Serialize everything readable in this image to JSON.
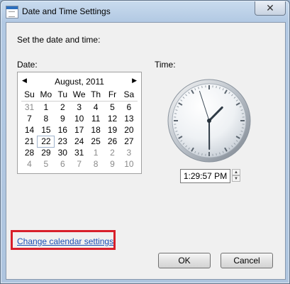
{
  "window": {
    "title": "Date and Time Settings",
    "close_glyph": "✕",
    "instruction": "Set the date and time:"
  },
  "date": {
    "label": "Date:",
    "month_title": "August, 2011",
    "prev_glyph": "◀",
    "next_glyph": "▶",
    "weekdays": [
      "Su",
      "Mo",
      "Tu",
      "We",
      "Th",
      "Fr",
      "Sa"
    ],
    "weeks": [
      [
        "31",
        "1",
        "2",
        "3",
        "4",
        "5",
        "6"
      ],
      [
        "7",
        "8",
        "9",
        "10",
        "11",
        "12",
        "13"
      ],
      [
        "14",
        "15",
        "16",
        "17",
        "18",
        "19",
        "20"
      ],
      [
        "21",
        "22",
        "23",
        "24",
        "25",
        "26",
        "27"
      ],
      [
        "28",
        "29",
        "30",
        "31",
        "1",
        "2",
        "3"
      ],
      [
        "4",
        "5",
        "6",
        "7",
        "8",
        "9",
        "10"
      ]
    ],
    "selected_day": "22"
  },
  "time": {
    "label": "Time:",
    "value": "1:29:57 PM",
    "clock": {
      "hour": 1,
      "minute": 29,
      "second": 57
    }
  },
  "links": {
    "change_calendar": "Change calendar settings"
  },
  "buttons": {
    "ok": "OK",
    "cancel": "Cancel"
  },
  "colors": {
    "highlight_box": "#d81f2a",
    "link": "#1a4fb5"
  }
}
